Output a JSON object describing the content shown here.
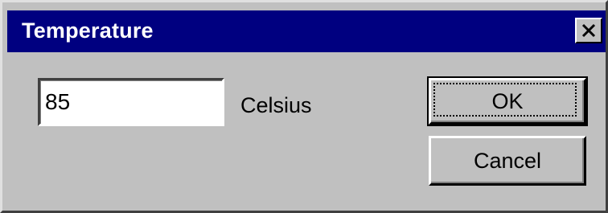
{
  "window": {
    "title": "Temperature",
    "close_icon": "close-icon"
  },
  "form": {
    "temperature_value": "85",
    "unit_label": "Celsius"
  },
  "buttons": {
    "ok_label": "OK",
    "cancel_label": "Cancel"
  },
  "colors": {
    "titlebar": "#000080",
    "face": "#c0c0c0"
  }
}
